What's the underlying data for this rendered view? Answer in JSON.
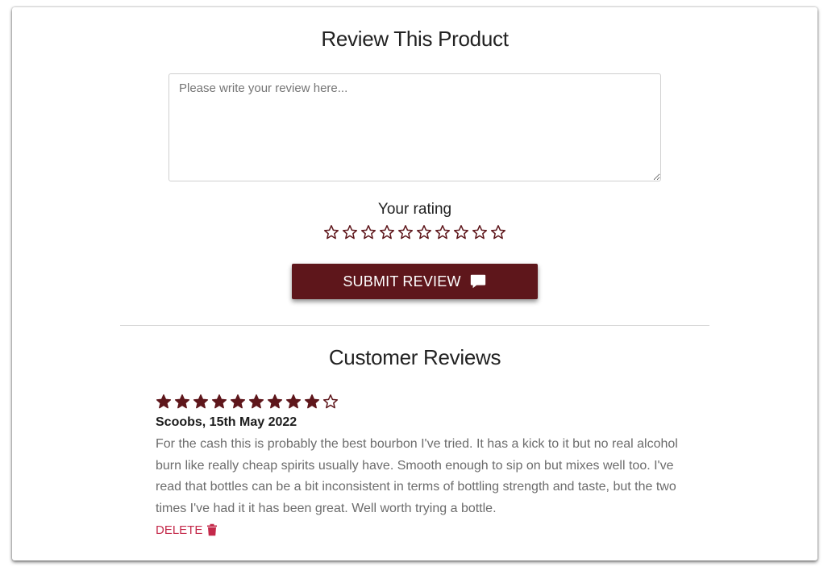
{
  "form": {
    "title": "Review This Product",
    "placeholder": "Please write your review here...",
    "rating_label": "Your rating",
    "rating_max": 10,
    "rating_value": 0,
    "submit_label": "SUBMIT REVIEW",
    "submit_icon": "comment-icon"
  },
  "reviews": {
    "title": "Customer Reviews",
    "items": [
      {
        "rating": 9,
        "rating_max": 10,
        "author_date": "Scoobs, 15th May 2022",
        "text": "For the cash this is probably the best bourbon I've tried. It has a kick to it but no real alcohol burn like really cheap spirits usually have. Smooth enough to sip on but mixes well too. I've read that bottles can be a bit inconsistent in terms of bottling strength and taste, but the two times I've had it it has been great. Well worth trying a bottle.",
        "delete_label": "DELETE",
        "delete_icon": "trash-icon"
      }
    ]
  },
  "colors": {
    "accent": "#5e161b",
    "star": "#5e161b",
    "delete": "#c4294a",
    "text_muted": "#6c6c6c"
  }
}
